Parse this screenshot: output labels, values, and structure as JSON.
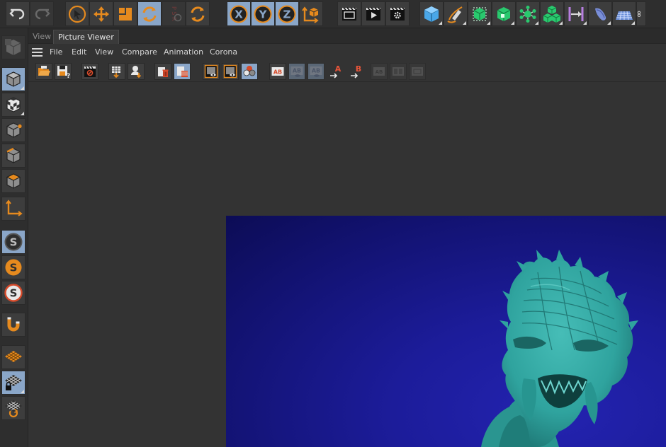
{
  "tabs": [
    {
      "label": "View",
      "active": false
    },
    {
      "label": "Picture Viewer",
      "active": true
    }
  ],
  "menu": [
    "File",
    "Edit",
    "View",
    "Compare",
    "Animation",
    "Corona"
  ],
  "toolbar": {
    "undo": "undo-icon",
    "redo": "redo-icon",
    "tools": [
      "select-icon",
      "move-icon",
      "scale-icon",
      "rotate-icon",
      "psr-icon",
      "recent-icon"
    ],
    "axis": [
      "X",
      "Y",
      "Z"
    ],
    "coord": "coordinate-system-icon",
    "render": [
      "render-view-icon",
      "render-picture-viewer-icon",
      "render-settings-icon"
    ],
    "objects": [
      "cube-icon",
      "pen-icon",
      "subdivision-icon",
      "extrude-icon",
      "cloner-icon",
      "effector-icon",
      "deformer-icon",
      "bend-icon",
      "floor-icon",
      "camera-icon"
    ]
  },
  "psr_text": "P S R",
  "colors": {
    "accent_orange": "#e68a1e",
    "selected_blue": "#8aa6c8",
    "render_bg": "#1c1c9a",
    "model_teal": "#2fa39e"
  }
}
